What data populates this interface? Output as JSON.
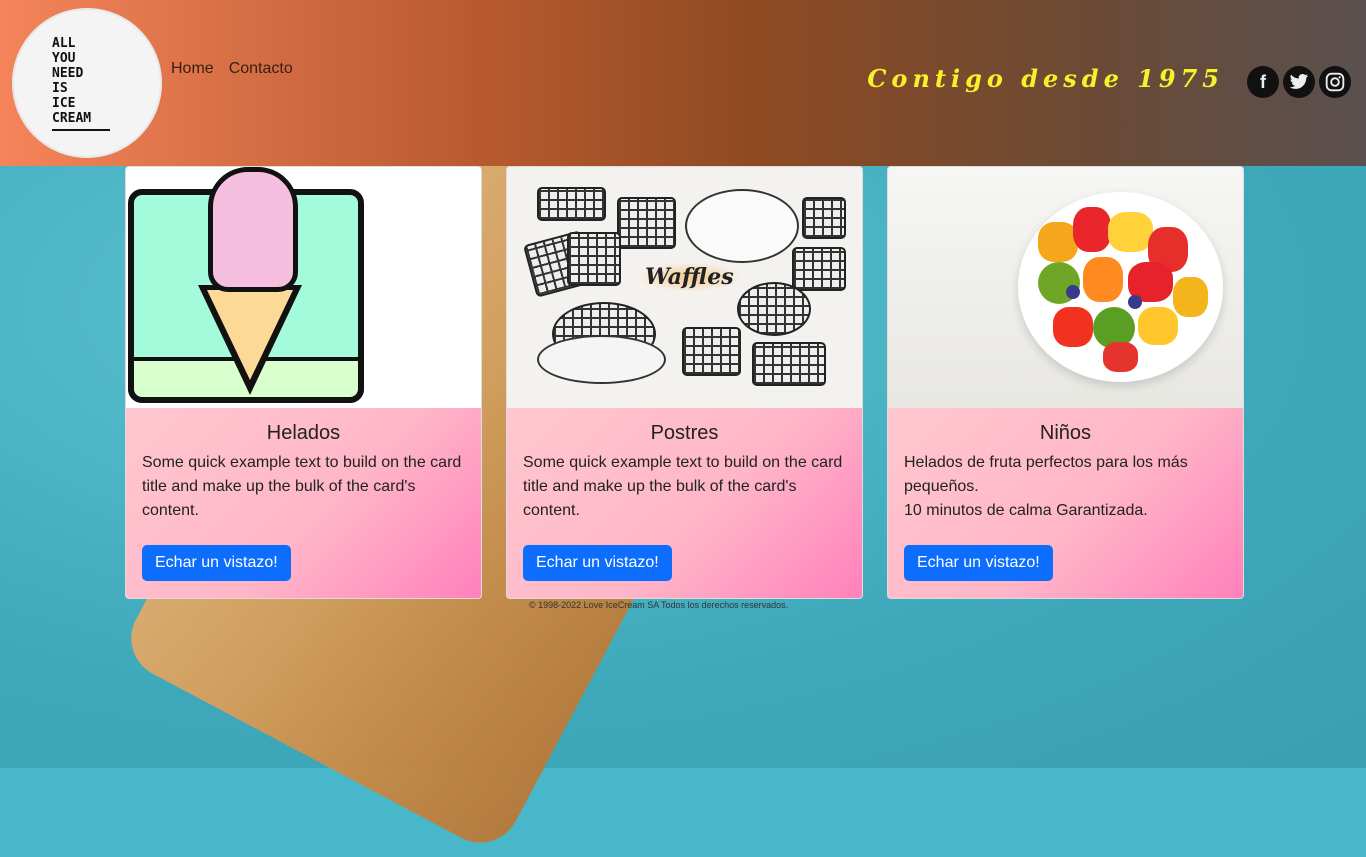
{
  "header": {
    "logo_lines": [
      "ALL",
      "YOU",
      "NEED",
      "IS",
      "ICE",
      "CREAM"
    ],
    "nav": [
      {
        "label": "Home"
      },
      {
        "label": "Contacto"
      }
    ],
    "slogan": "Contigo desde 1975",
    "social": [
      {
        "icon": "facebook-icon",
        "glyph": "f"
      },
      {
        "icon": "twitter-icon",
        "glyph": "t"
      },
      {
        "icon": "instagram-icon",
        "glyph": "◎"
      }
    ]
  },
  "cards": [
    {
      "title": "Helados",
      "text": "Some quick example text to build on the card title and make up the bulk of the card's content.",
      "button": "Echar un vistazo!"
    },
    {
      "title": "Postres",
      "text": "Some quick example text to build on the card title and make up the bulk of the card's content.",
      "button": "Echar un vistazo!",
      "image_label": "Waffles"
    },
    {
      "title": "Niños",
      "text": "Helados de fruta perfectos para los más pequeños.\n10 minutos de calma Garantizada.",
      "button": "Echar un vistazo!"
    }
  ],
  "footer": "© 1998-2022 Love IceCream SA Todos los derechos reservados.",
  "colors": {
    "button": "#0d6efd",
    "slogan": "#f7f02a",
    "card_body_start": "#ffc7cf",
    "card_body_end": "#ff69b4"
  }
}
